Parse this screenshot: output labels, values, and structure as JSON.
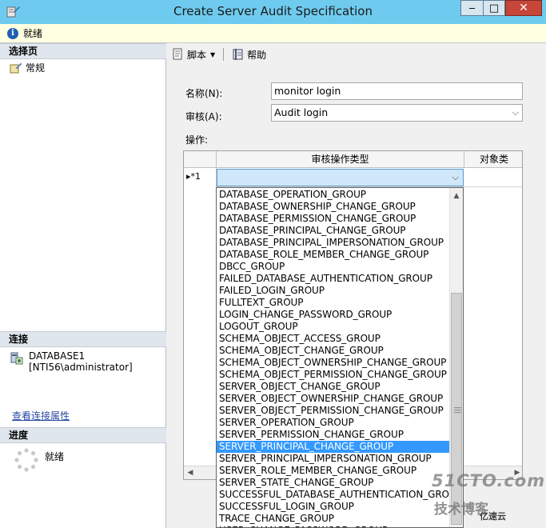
{
  "window": {
    "title": "Create Server Audit Specification",
    "minimize_glyph": "‒",
    "maximize_glyph": "□",
    "close_glyph": "✕"
  },
  "status": {
    "text": "就绪"
  },
  "left": {
    "select_page_header": "选择页",
    "pages": [
      {
        "label": "常规"
      }
    ],
    "connection_header": "连接",
    "connection_server": "DATABASE1",
    "connection_user": "[NTI56\\administrator]",
    "view_connection_link": "查看连接属性",
    "progress_header": "进度",
    "progress_text": "就绪"
  },
  "toolbar": {
    "script_label": "脚本",
    "help_label": "帮助"
  },
  "form": {
    "name_label": "名称(N):",
    "name_value": "monitor login",
    "audit_label": "审核(A):",
    "audit_value": "Audit login",
    "actions_label": "操作:"
  },
  "grid": {
    "columns": [
      "审核操作类型",
      "对象类"
    ],
    "rows": [
      {
        "row_header": "▸*1",
        "action_type": ""
      }
    ]
  },
  "dropdown": {
    "items": [
      "DATABASE_OPERATION_GROUP",
      "DATABASE_OWNERSHIP_CHANGE_GROUP",
      "DATABASE_PERMISSION_CHANGE_GROUP",
      "DATABASE_PRINCIPAL_CHANGE_GROUP",
      "DATABASE_PRINCIPAL_IMPERSONATION_GROUP",
      "DATABASE_ROLE_MEMBER_CHANGE_GROUP",
      "DBCC_GROUP",
      "FAILED_DATABASE_AUTHENTICATION_GROUP",
      "FAILED_LOGIN_GROUP",
      "FULLTEXT_GROUP",
      "LOGIN_CHANGE_PASSWORD_GROUP",
      "LOGOUT_GROUP",
      "SCHEMA_OBJECT_ACCESS_GROUP",
      "SCHEMA_OBJECT_CHANGE_GROUP",
      "SCHEMA_OBJECT_OWNERSHIP_CHANGE_GROUP",
      "SCHEMA_OBJECT_PERMISSION_CHANGE_GROUP",
      "SERVER_OBJECT_CHANGE_GROUP",
      "SERVER_OBJECT_OWNERSHIP_CHANGE_GROUP",
      "SERVER_OBJECT_PERMISSION_CHANGE_GROUP",
      "SERVER_OPERATION_GROUP",
      "SERVER_PERMISSION_CHANGE_GROUP",
      "SERVER_PRINCIPAL_CHANGE_GROUP",
      "SERVER_PRINCIPAL_IMPERSONATION_GROUP",
      "SERVER_ROLE_MEMBER_CHANGE_GROUP",
      "SERVER_STATE_CHANGE_GROUP",
      "SUCCESSFUL_DATABASE_AUTHENTICATION_GROUP",
      "SUCCESSFUL_LOGIN_GROUP",
      "TRACE_CHANGE_GROUP",
      "USER_CHANGE_PASSWORD_GROUP"
    ],
    "selected_index": 21
  },
  "watermark": {
    "line1": "51CTO.com",
    "line2": "技术博客",
    "line3": "亿速云"
  },
  "colors": {
    "titlebar": "#6ecbef",
    "selection": "#3399ff",
    "status_bg": "#ffffe1",
    "close": "#c7463a"
  }
}
